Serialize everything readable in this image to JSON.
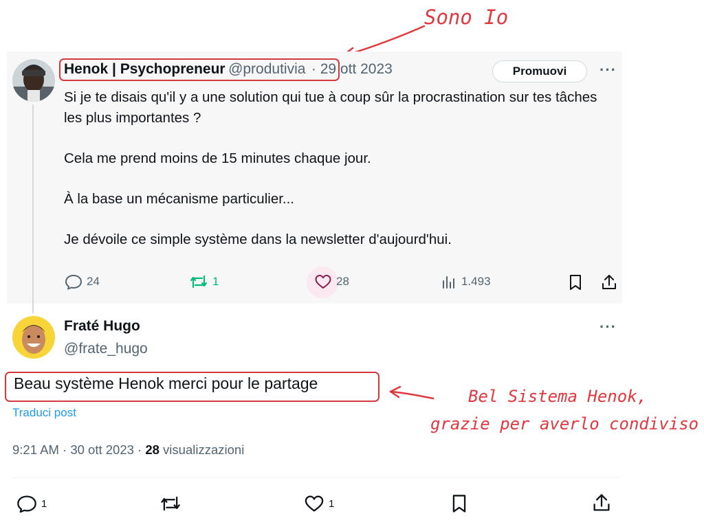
{
  "annotations": {
    "top_label": "Sono Io",
    "side_label_line1": "Bel Sistema Henok,",
    "side_label_line2": "grazie per averlo condiviso",
    "color": "#e0383e"
  },
  "original_tweet": {
    "author_name": "Henok | Psychopreneur",
    "author_handle": "@produtivia",
    "date": "· 29 ott 2023",
    "promote_label": "Promuovi",
    "more_icon": "···",
    "paragraphs": [
      "Si je te disais qu'il y a une solution qui tue à coup sûr la procrastination sur tes tâches les plus importantes ?",
      "Cela me prend moins de 15 minutes chaque jour.",
      "À la base un mécanisme particulier...",
      "Je dévoile ce simple système dans la newsletter d'aujourd'hui."
    ],
    "stats": {
      "replies": "24",
      "retweets": "1",
      "likes": "28",
      "views": "1.493"
    },
    "colors": {
      "retweet_active": "#00ba7c",
      "like_highlight": "#f91880"
    }
  },
  "reply_tweet": {
    "author_name": "Fraté Hugo",
    "author_handle": "@frate_hugo",
    "more_icon": "···",
    "text": "Beau système Henok merci pour le partage",
    "translate_label": "Traduci post",
    "time_date": "9:21 AM · 30 ott 2023 · ",
    "views_count": "28",
    "views_label": " visualizzazioni",
    "stats": {
      "replies": "1",
      "likes": "1"
    }
  },
  "accent_color": "#1d9bf0"
}
